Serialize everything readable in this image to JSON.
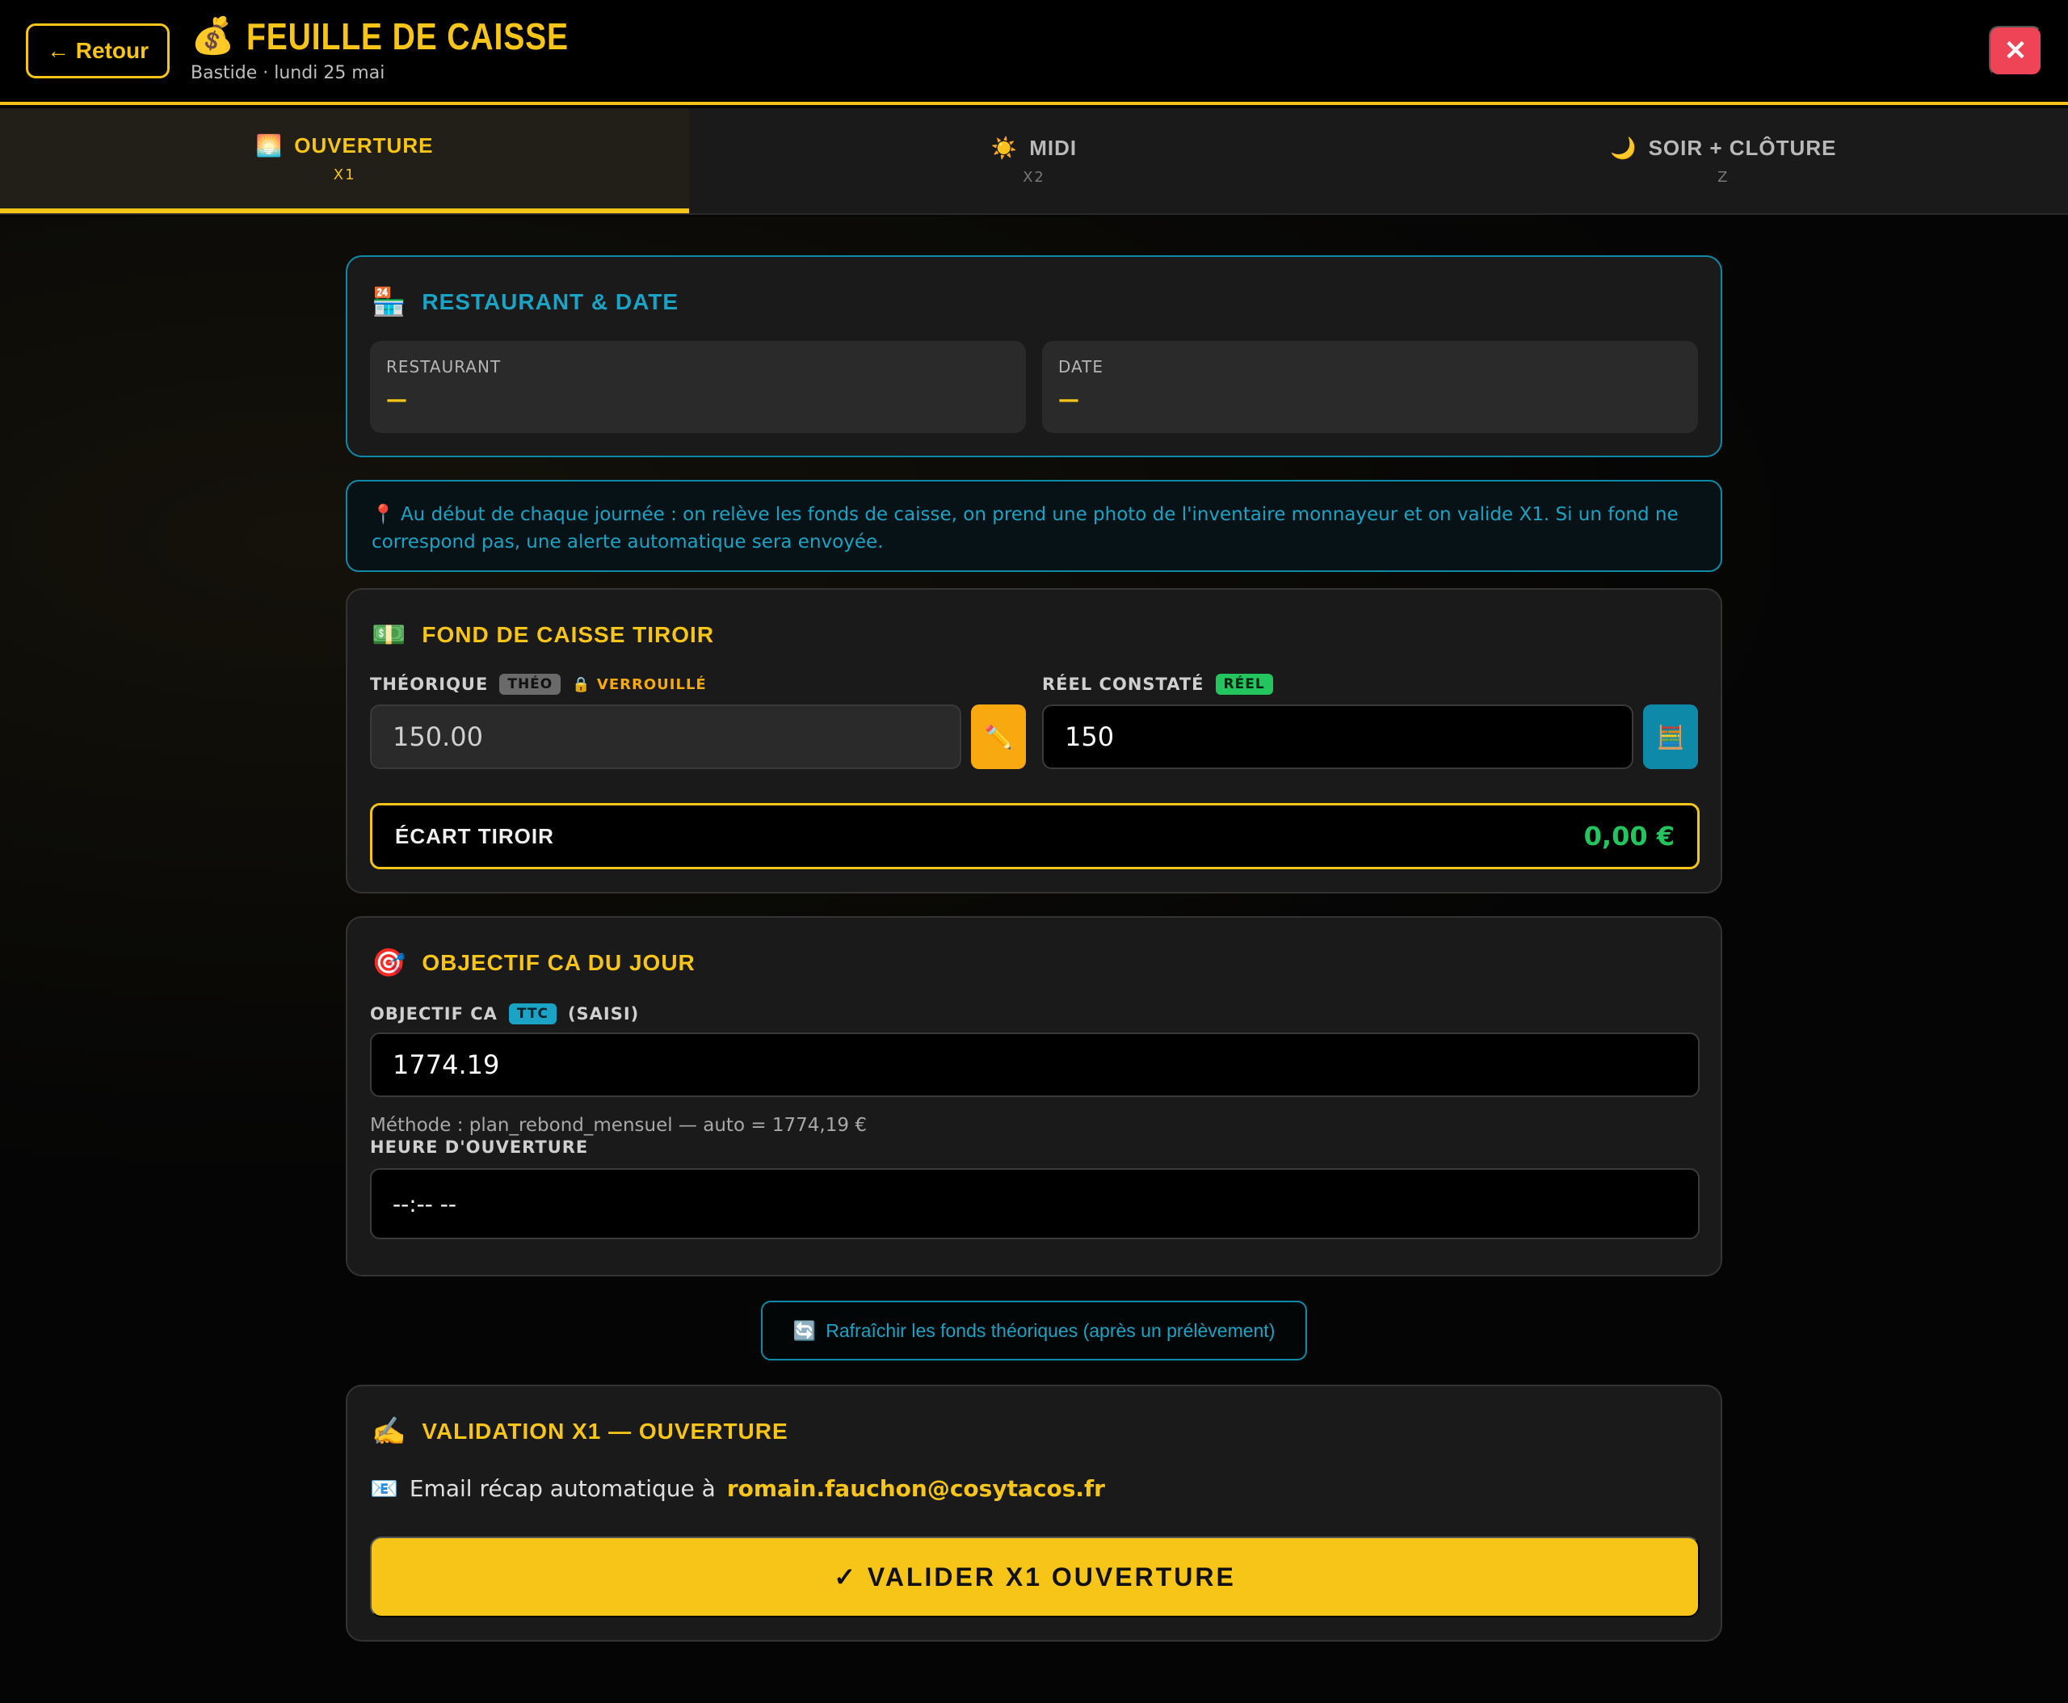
{
  "header": {
    "back_label": "← Retour",
    "title_icon": "💰",
    "title": "FEUILLE DE CAISSE",
    "subtitle": "Bastide · lundi 25 mai",
    "close_label": "✕"
  },
  "tabs": [
    {
      "icon": "🌅",
      "label": "OUVERTURE",
      "sub": "X1",
      "active": true
    },
    {
      "icon": "☀️",
      "label": "MIDI",
      "sub": "X2",
      "active": false
    },
    {
      "icon": "🌙",
      "label": "SOIR + CLÔTURE",
      "sub": "Z",
      "active": false
    }
  ],
  "restaurant_date": {
    "icon": "🏪",
    "title": "RESTAURANT & DATE",
    "restaurant_label": "RESTAURANT",
    "restaurant_value": "—",
    "date_label": "DATE",
    "date_value": "—"
  },
  "info": {
    "icon": "📍",
    "text": "Au début de chaque journée : on relève les fonds de caisse, on prend une photo de l'inventaire monnayeur et on valide X1. Si un fond ne correspond pas, une alerte automatique sera envoyée."
  },
  "fond": {
    "icon": "💵",
    "title": "FOND DE CAISSE TIROIR",
    "theorique_label": "THÉORIQUE",
    "theo_badge": "THÉO",
    "locked_label": "🔒 VERROUILLÉ",
    "theorique_value": "150.00",
    "edit_icon": "✏️",
    "reel_label": "RÉEL CONSTATÉ",
    "reel_badge": "RÉEL",
    "reel_value": "150",
    "calc_icon": "🧮",
    "ecart_label": "ÉCART TIROIR",
    "ecart_value": "0,00 €"
  },
  "objectif": {
    "icon": "🎯",
    "title": "OBJECTIF CA DU JOUR",
    "ca_label": "OBJECTIF CA",
    "ttc_badge": "TTC",
    "saisi_label": "(SAISI)",
    "ca_value": "1774.19",
    "method": "Méthode : plan_rebond_mensuel — auto = 1774,19 €",
    "heure_label": "HEURE D'OUVERTURE",
    "heure_value": "--:-- --"
  },
  "refresh": {
    "icon": "🔄",
    "label": "Rafraîchir les fonds théoriques (après un prélèvement)"
  },
  "validation": {
    "icon": "✍️",
    "title": "VALIDATION X1 — OUVERTURE",
    "email_icon": "📧",
    "email_prefix": "Email récap automatique à",
    "email": "romain.fauchon@cosytacos.fr",
    "button_label": "✓ VALIDER X1 OUVERTURE"
  },
  "colors": {
    "accent": "#f7c517",
    "info": "#1aa3c4",
    "success": "#22c55e",
    "danger": "#ef4456"
  }
}
